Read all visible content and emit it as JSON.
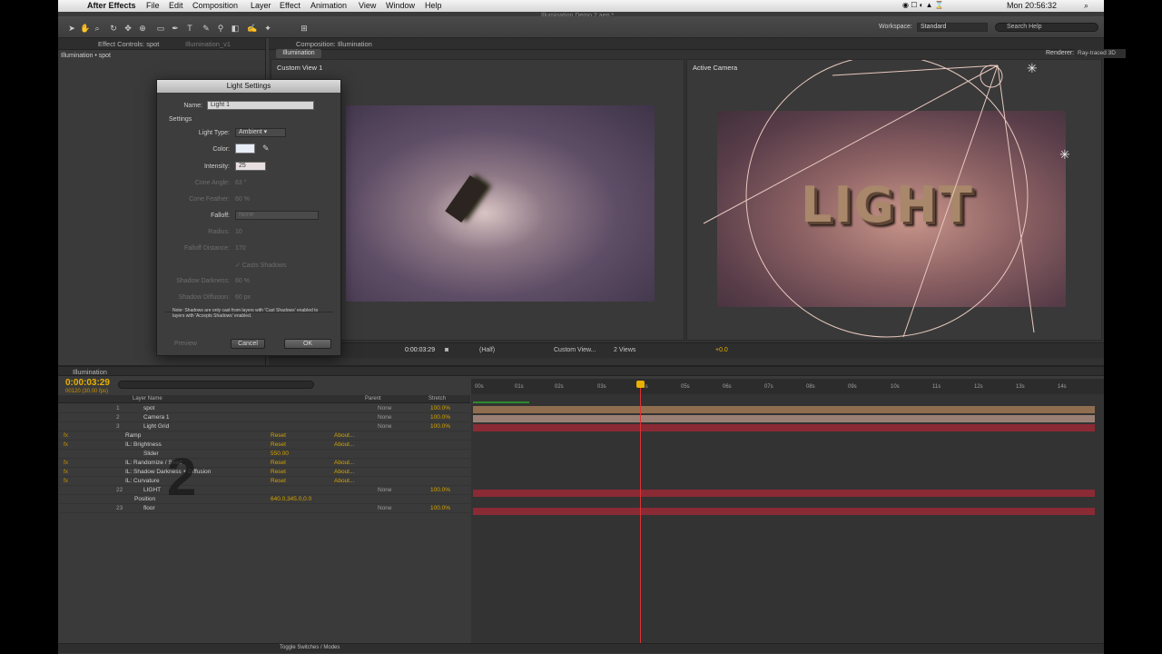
{
  "menubar": {
    "apple": "",
    "app": "After Effects",
    "items": [
      "File",
      "Edit",
      "Composition",
      "Layer",
      "Effect",
      "Animation",
      "View",
      "Window",
      "Help"
    ],
    "clock": "Mon 20:56:32"
  },
  "window_title": "Illumination Demo 2.aep *",
  "toolbar": {
    "workspace_label": "Workspace:",
    "workspace_value": "Standard",
    "search_help": "Search Help"
  },
  "effect_panel": {
    "tab1": "Effect Controls: spot",
    "tab2": "Illumination_v1",
    "breadcrumb": "Illumination • spot"
  },
  "comp_panel": {
    "tab": "Composition: Illumination",
    "subtab": "Illumination",
    "renderer_label": "Renderer:",
    "renderer_value": "Ray-traced 3D",
    "view1_label": "Custom View 1",
    "view2_label": "Active Camera",
    "render2_text": "LIGHT",
    "viewer_bar": {
      "timecode": "0:00:03:29",
      "resolution": "(Half)",
      "view": "Custom View...",
      "views": "2 Views",
      "exposure": "+0.0"
    }
  },
  "dialog": {
    "title": "Light Settings",
    "name_label": "Name:",
    "name_value": "Light 1",
    "settings_label": "Settings",
    "light_type_label": "Light Type:",
    "light_type_value": "Ambient",
    "color_label": "Color:",
    "color_value": "#e8eef8",
    "intensity_label": "Intensity:",
    "intensity_value": "25",
    "cone_angle_label": "Cone Angle:",
    "cone_angle_value": "63 °",
    "cone_feather_label": "Cone Feather:",
    "cone_feather_value": "60 %",
    "falloff_label": "Falloff:",
    "falloff_value": "None",
    "radius_label": "Radius:",
    "radius_value": "10",
    "falloff_distance_label": "Falloff Distance:",
    "falloff_distance_value": "170",
    "cast_shadows_label": "Casts Shadows",
    "shadow_darkness_label": "Shadow Darkness:",
    "shadow_darkness_value": "60 %",
    "shadow_diffusion_label": "Shadow Diffusion:",
    "shadow_diffusion_value": "60 px",
    "note": "Note: Shadows are only cast from layers with 'Cast Shadows' enabled to layers with 'Accepts Shadows' enabled.",
    "preview_label": "Preview",
    "cancel_label": "Cancel",
    "ok_label": "OK"
  },
  "timeline": {
    "tab": "Illumination",
    "timecode": "0:00:03:29",
    "timecode_sub": "00120 (30.00 fps)",
    "col_layer_name": "Layer Name",
    "col_parent": "Parent",
    "col_stretch": "Stretch",
    "ticks": [
      "00s",
      "01s",
      "02s",
      "03s",
      "04s",
      "05s",
      "06s",
      "07s",
      "08s",
      "09s",
      "10s",
      "11s",
      "12s",
      "13s",
      "14s"
    ],
    "rows": [
      {
        "num": "1",
        "name": "spot",
        "parent": "None",
        "stretch": "100.0%"
      },
      {
        "num": "2",
        "name": "Camera 1",
        "parent": "None",
        "stretch": "100.0%"
      },
      {
        "num": "3",
        "name": "Light Grid",
        "parent": "None",
        "stretch": "100.0%"
      },
      {
        "name": "Ramp",
        "reset": "Reset",
        "about": "About..."
      },
      {
        "name": "IL: Brightness",
        "reset": "Reset",
        "about": "About..."
      },
      {
        "name": "Slider",
        "value": "550.00"
      },
      {
        "name": "IL: Randomize / Seed",
        "reset": "Reset",
        "about": "About..."
      },
      {
        "name": "IL: Shadow Darkness + Diffusion",
        "reset": "Reset",
        "about": "About..."
      },
      {
        "name": "IL: Curvature",
        "reset": "Reset",
        "about": "About..."
      },
      {
        "num": "22",
        "name": "LIGHT",
        "parent": "None",
        "stretch": "100.0%"
      },
      {
        "name": "Position",
        "value": "640.0,345.0,0.0"
      },
      {
        "num": "23",
        "name": "floor",
        "parent": "None",
        "stretch": "100.0%"
      }
    ],
    "toggle_label": "Toggle Switches / Modes",
    "overlay_number": "2"
  }
}
